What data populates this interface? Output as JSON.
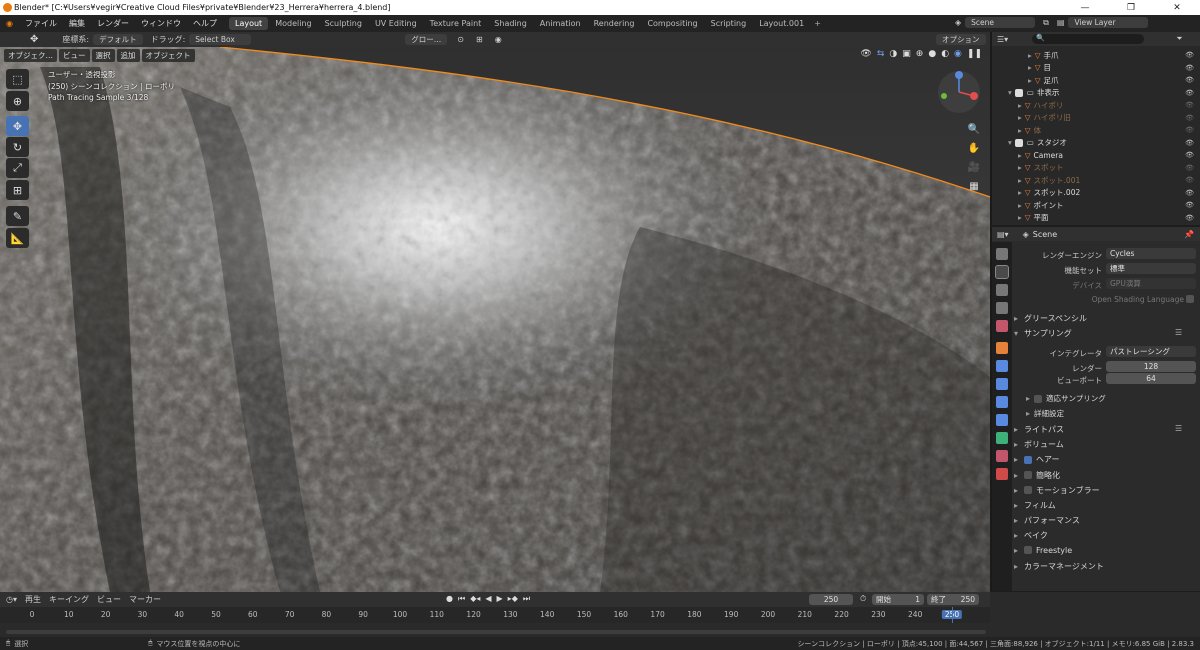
{
  "window": {
    "title": "Blender* [C:¥Users¥vegir¥Creative Cloud Files¥private¥Blender¥23_Herrera¥herrera_4.blend]"
  },
  "menu": [
    "ファイル",
    "編集",
    "レンダー",
    "ウィンドウ",
    "ヘルプ"
  ],
  "workspaces": [
    "Layout",
    "Modeling",
    "Sculpting",
    "UV Editing",
    "Texture Paint",
    "Shading",
    "Animation",
    "Rendering",
    "Compositing",
    "Scripting",
    "Layout.001"
  ],
  "active_workspace": "Layout",
  "scene": "Scene",
  "view_layer": "View Layer",
  "header": {
    "coord_label": "座標系:",
    "orientation": "デフォルト",
    "drag": "ドラッグ:",
    "select_mode": "Select Box",
    "transform": "グロー…",
    "options": "オプション"
  },
  "viewport": {
    "menu": [
      "オブジェク…",
      "ビュー",
      "選択",
      "追加",
      "オブジェクト"
    ],
    "info": [
      "ユーザー・透視投影",
      "(250) シーンコレクション | ローポリ",
      "Path Tracing Sample 3/128"
    ]
  },
  "outliner": {
    "rows": [
      {
        "label": "手爪",
        "indent": 3,
        "color": "#e5813a",
        "dim": false
      },
      {
        "label": "目",
        "indent": 3,
        "color": "#e5813a",
        "dim": false
      },
      {
        "label": "足爪",
        "indent": 3,
        "color": "#e5813a",
        "dim": false
      },
      {
        "label": "非表示",
        "indent": 1,
        "color": "#dcdcdc",
        "dim": false,
        "collection": true
      },
      {
        "label": "ハイポリ",
        "indent": 2,
        "color": "#e5813a",
        "dim": true
      },
      {
        "label": "ハイポリ旧",
        "indent": 2,
        "color": "#e5813a",
        "dim": true
      },
      {
        "label": "体",
        "indent": 2,
        "color": "#e5813a",
        "dim": true
      },
      {
        "label": "スタジオ",
        "indent": 1,
        "color": "#dcdcdc",
        "dim": false,
        "collection": true
      },
      {
        "label": "Camera",
        "indent": 2,
        "color": "#e5813a",
        "dim": false
      },
      {
        "label": "スポット",
        "indent": 2,
        "color": "#e5813a",
        "dim": true
      },
      {
        "label": "スポット.001",
        "indent": 2,
        "color": "#e5813a",
        "dim": true
      },
      {
        "label": "スポット.002",
        "indent": 2,
        "color": "#e5813a",
        "dim": false
      },
      {
        "label": "ポイント",
        "indent": 2,
        "color": "#e5813a",
        "dim": false
      },
      {
        "label": "平面",
        "indent": 2,
        "color": "#e5813a",
        "dim": false
      }
    ]
  },
  "properties": {
    "scene_name": "Scene",
    "render_engine_label": "レンダーエンジン",
    "render_engine": "Cycles",
    "feature_set_label": "機能セット",
    "feature_set": "標準",
    "device_label": "デバイス",
    "device": "GPU演算",
    "osl_label": "Open Shading Language",
    "grease_pencil": "グリースペンシル",
    "sampling": "サンプリング",
    "integrator_label": "インテグレータ",
    "integrator": "パストレーシング",
    "render_label": "レンダー",
    "render_samples": "128",
    "viewport_label": "ビューポート",
    "viewport_samples": "64",
    "adaptive": "適応サンプリング",
    "advanced": "詳細設定",
    "panels": [
      {
        "label": "ライトパス",
        "check": null
      },
      {
        "label": "ボリューム",
        "check": null
      },
      {
        "label": "ヘアー",
        "check": true
      },
      {
        "label": "簡略化",
        "check": false
      },
      {
        "label": "モーションブラー",
        "check": false
      },
      {
        "label": "フィルム",
        "check": null
      },
      {
        "label": "パフォーマンス",
        "check": null
      },
      {
        "label": "ベイク",
        "check": null
      },
      {
        "label": "Freestyle",
        "check": false
      },
      {
        "label": "カラーマネージメント",
        "check": null
      }
    ]
  },
  "timeline": {
    "menu": [
      "再生",
      "キーイング",
      "ビュー",
      "マーカー"
    ],
    "current_frame": "250",
    "start_label": "開始",
    "start": "1",
    "end_label": "終了",
    "end": "250",
    "ticks": [
      "0",
      "10",
      "20",
      "30",
      "40",
      "50",
      "60",
      "70",
      "80",
      "90",
      "100",
      "110",
      "120",
      "130",
      "140",
      "150",
      "160",
      "170",
      "180",
      "190",
      "200",
      "210",
      "220",
      "230",
      "240",
      "250"
    ]
  },
  "status": {
    "left": "選択",
    "mid": "マウス位置を視点の中心に",
    "right": "シーンコレクション | ローポリ | 頂点:45,100 | 面:44,567 | 三角面:88,926 | オブジェクト:1/11 | メモリ:6.85 GiB | 2.83.3"
  }
}
